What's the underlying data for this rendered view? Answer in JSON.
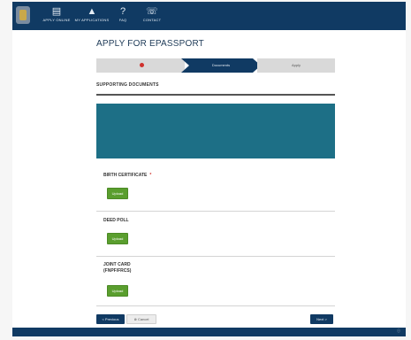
{
  "nav": {
    "items": [
      {
        "icon": "apply-online-icon",
        "label": "APPLY ONLINE"
      },
      {
        "icon": "applications-icon",
        "label": "MY APPLICATIONS"
      },
      {
        "icon": "faq-icon",
        "label": "FAQ"
      },
      {
        "icon": "contact-icon",
        "label": "CONTACT"
      }
    ]
  },
  "page": {
    "title": "APPLY FOR EPASSPORT",
    "steps": [
      "",
      "Documents",
      "Apply"
    ]
  },
  "documents": {
    "section_title": "SUPPORTING DOCUMENTS",
    "items": [
      {
        "label": "BIRTH CERTIFICATE",
        "required": true,
        "button": "Upload"
      },
      {
        "label": "DEED POLL",
        "required": false,
        "button": "Upload"
      },
      {
        "label": "JOINT CARD\n(FNPF/FRCS)",
        "required": false,
        "button": "Upload"
      }
    ]
  },
  "actions": {
    "previous": "< Previous",
    "cancel": "⊗ Cancel",
    "next": "Next >"
  },
  "colors": {
    "navy": "#103a63",
    "teal": "#1d6f86",
    "green": "#5a9e2e",
    "required_red": "#d0312d"
  }
}
